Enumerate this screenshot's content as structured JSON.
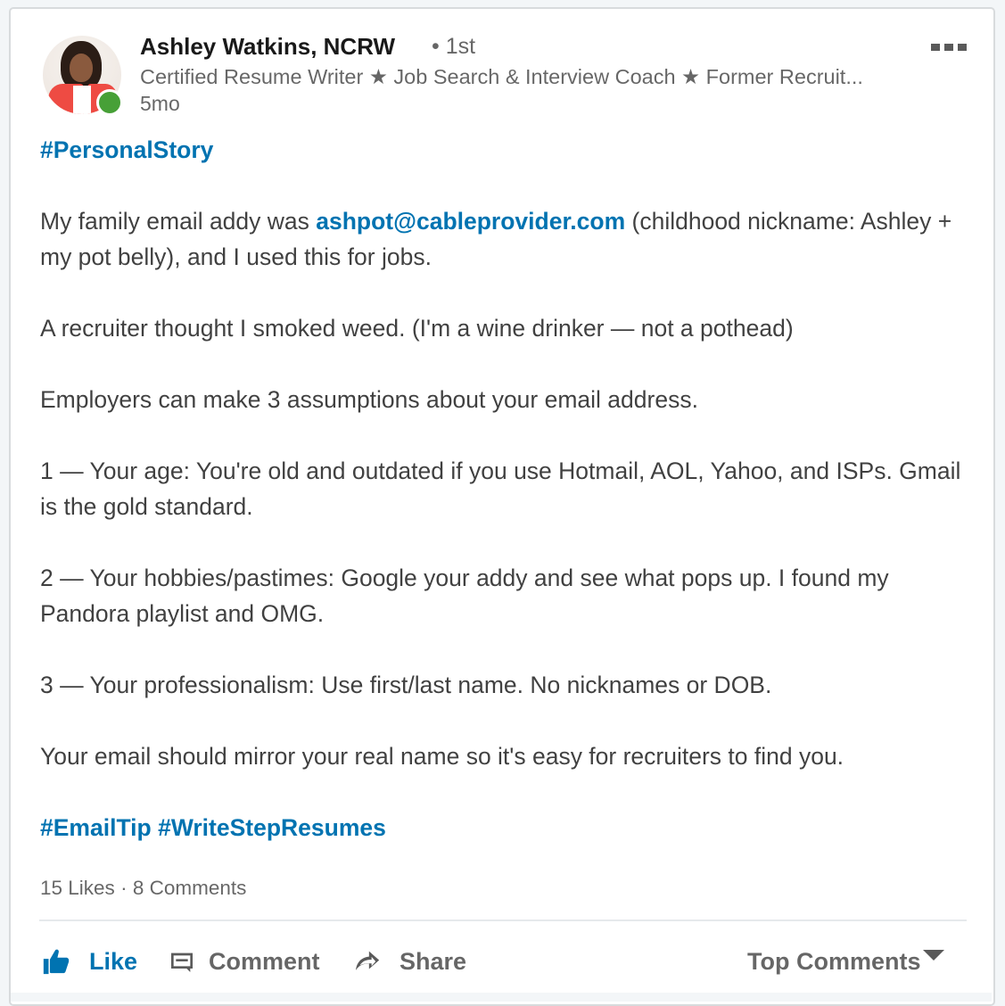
{
  "post": {
    "author": {
      "name": "Ashley Watkins, NCRW",
      "connection_degree": "• 1st",
      "headline": "Certified Resume Writer ★ Job Search & Interview Coach ★ Former Recruit...",
      "timestamp": "5mo",
      "online_status": "online"
    },
    "more_menu_icon": "ellipsis-icon",
    "body": {
      "hashtag_top": "#PersonalStory",
      "p1_before": "My family email addy was ",
      "p1_email": "ashpot@cableprovider.com",
      "p1_after": " (childhood nickname: Ashley + my pot belly), and I used this for jobs.",
      "p2": "A recruiter thought I smoked weed. (I'm a wine drinker — not a pothead)",
      "p3": "Employers can make 3 assumptions about your email address.",
      "p4": "1 — Your age: You're old and outdated if you use Hotmail, AOL, Yahoo, and ISPs. Gmail is the gold standard.",
      "p5": "2 — Your hobbies/pastimes: Google your addy and see what pops up. I found my Pandora playlist and OMG.",
      "p6": "3 — Your professionalism: Use first/last name. No nicknames or DOB.",
      "p7": "Your email should mirror your real name so it's easy for recruiters to find you.",
      "hashtags_bottom": [
        "#EmailTip",
        "#WriteStepResumes"
      ]
    },
    "social": {
      "likes": "15 Likes",
      "separator": " · ",
      "comments": "8 Comments"
    },
    "actions": {
      "like": "Like",
      "comment": "Comment",
      "share": "Share",
      "sort": "Top Comments"
    },
    "colors": {
      "link": "#0073b1",
      "presence": "#47a037"
    }
  }
}
